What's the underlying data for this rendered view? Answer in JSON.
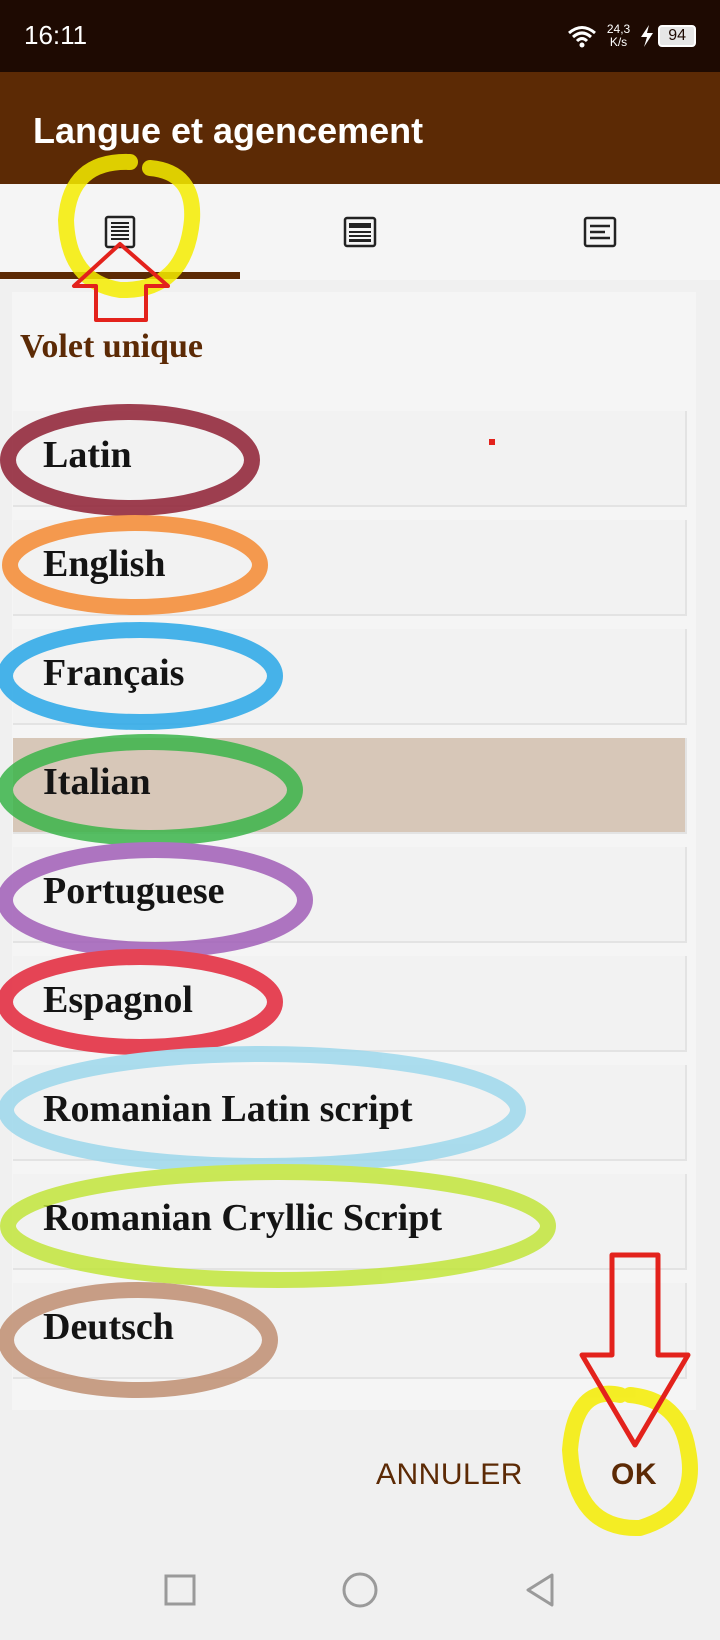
{
  "status": {
    "time": "16:11",
    "speed_value": "24,3",
    "speed_unit": "K/s",
    "battery": "94",
    "icons": [
      "wifi-icon",
      "charging-icon",
      "battery-icon"
    ]
  },
  "app_bar": {
    "title": "Langue et agencement"
  },
  "tabs": [
    {
      "name": "single-panel-tab",
      "icon": "single-column-layout-icon",
      "selected": true
    },
    {
      "name": "double-panel-tab",
      "icon": "multi-row-layout-icon",
      "selected": false
    },
    {
      "name": "split-panel-tab",
      "icon": "lines-layout-icon",
      "selected": false
    }
  ],
  "section": {
    "title": "Volet unique"
  },
  "languages": [
    {
      "label": "Latin",
      "selected": false
    },
    {
      "label": "English",
      "selected": false
    },
    {
      "label": "Français",
      "selected": false
    },
    {
      "label": "Italian",
      "selected": true
    },
    {
      "label": "Portuguese",
      "selected": false
    },
    {
      "label": "Espagnol",
      "selected": false
    },
    {
      "label": "Romanian Latin script",
      "selected": false
    },
    {
      "label": "Romanian Cryllic Script",
      "selected": false
    },
    {
      "label": "Deutsch",
      "selected": false
    }
  ],
  "actions": {
    "cancel": "ANNULER",
    "ok": "OK"
  },
  "nav": {
    "icons": [
      "recents-square-icon",
      "home-circle-icon",
      "back-triangle-icon"
    ]
  },
  "colors": {
    "brand_dark": "#5c2a05",
    "status_bar": "#1e0a02",
    "selected_row": "#d7c7b8",
    "annotation_yellow": "#f4ec00",
    "annotation_red": "#e3221c"
  }
}
